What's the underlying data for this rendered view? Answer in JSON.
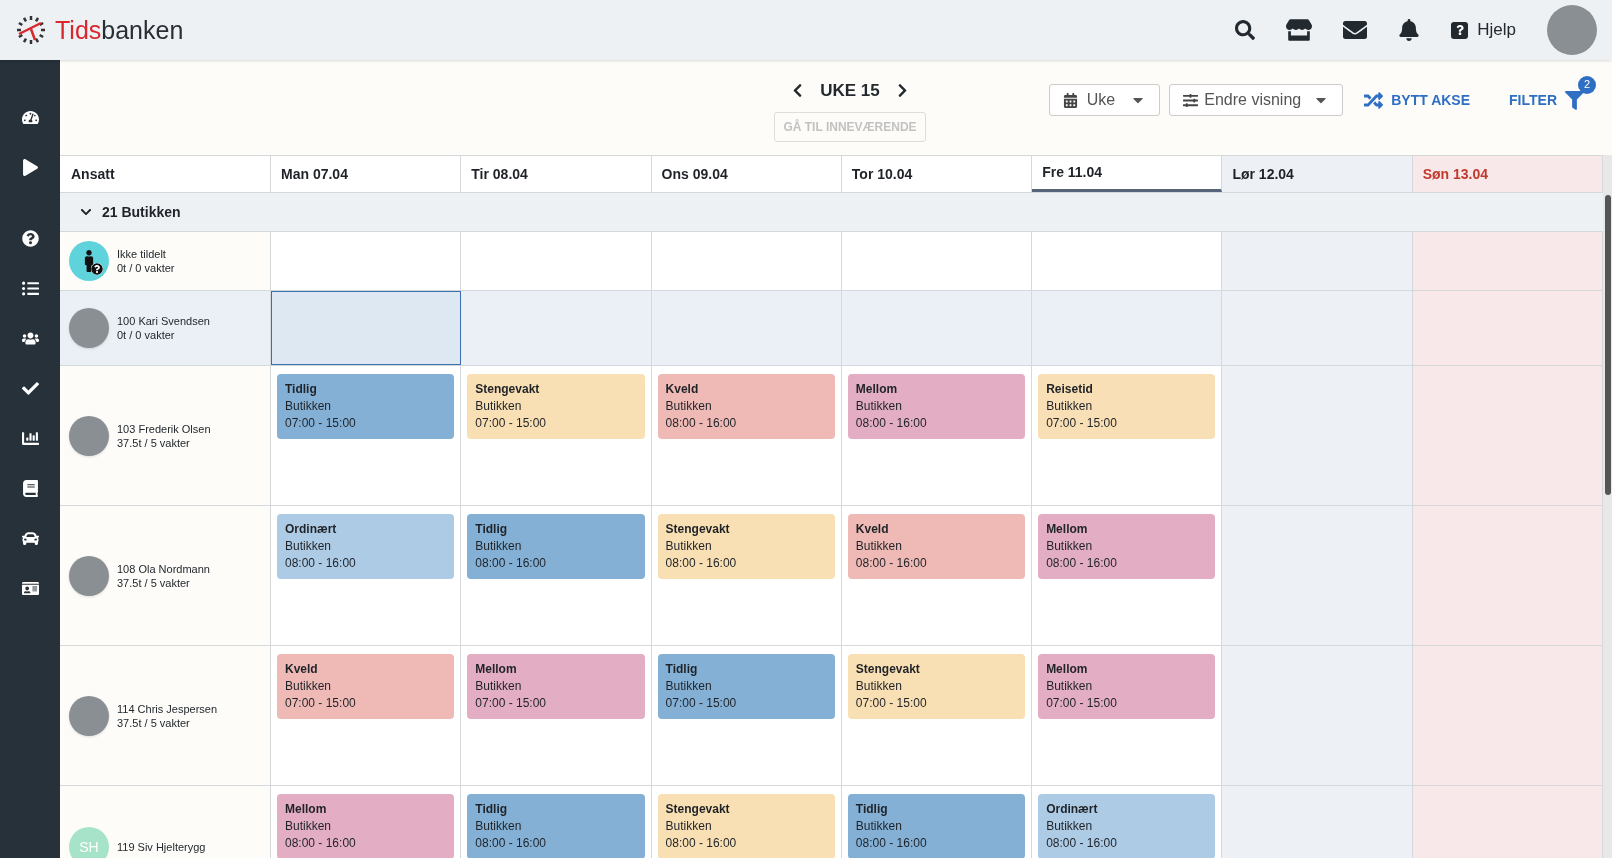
{
  "logo": {
    "accent": "Tids",
    "rest": "banken"
  },
  "header": {
    "help": "Hjelp"
  },
  "toolbar": {
    "week": "UKE 15",
    "goto_current": "GÅ TIL INNEVÆRENDE",
    "period_select": "Uke",
    "view_select": "Endre visning",
    "swap_axis": "BYTT AKSE",
    "filter": "FILTER",
    "filter_count": "2"
  },
  "table": {
    "employee_header": "Ansatt",
    "days": [
      {
        "label": "Man 07.04",
        "kind": "weekday",
        "selected": false
      },
      {
        "label": "Tir 08.04",
        "kind": "weekday",
        "selected": false
      },
      {
        "label": "Ons 09.04",
        "kind": "weekday",
        "selected": false
      },
      {
        "label": "Tor 10.04",
        "kind": "weekday",
        "selected": false
      },
      {
        "label": "Fre 11.04",
        "kind": "weekday",
        "selected": true
      },
      {
        "label": "Lør 12.04",
        "kind": "saturday",
        "selected": false
      },
      {
        "label": "Søn 13.04",
        "kind": "sunday",
        "selected": false
      }
    ],
    "group": {
      "label": "21 Butikken",
      "expanded": true
    },
    "employees": [
      {
        "name": "Ikke tildelt",
        "hours": "0t / 0 vakter",
        "avatar": {
          "kind": "unassigned"
        },
        "selected": false,
        "cells": [
          {
            "selected": false
          },
          {
            "selected": false
          },
          {
            "selected": false
          },
          {
            "selected": false
          },
          {
            "selected": false
          },
          {
            "selected": false
          },
          {
            "selected": false
          }
        ]
      },
      {
        "name": "100 Kari Svendsen",
        "hours": "0t / 0 vakter",
        "avatar": {
          "kind": "photo"
        },
        "selected": true,
        "cells": [
          {
            "selected": true
          },
          {
            "selected": false
          },
          {
            "selected": false
          },
          {
            "selected": false
          },
          {
            "selected": false
          },
          {
            "selected": false
          },
          {
            "selected": false
          }
        ]
      },
      {
        "name": "103 Frederik Olsen",
        "hours": "37.5t / 5 vakter",
        "avatar": {
          "kind": "photo"
        },
        "selected": false,
        "cells": [
          {
            "selected": false,
            "shift": {
              "title": "Tidlig",
              "place": "Butikken",
              "time": "07:00 - 15:00",
              "color": "#84b0d6"
            }
          },
          {
            "selected": false,
            "shift": {
              "title": "Stengevakt",
              "place": "Butikken",
              "time": "07:00 - 15:00",
              "color": "#f9dfb4"
            }
          },
          {
            "selected": false,
            "shift": {
              "title": "Kveld",
              "place": "Butikken",
              "time": "08:00 - 16:00",
              "color": "#efbab6"
            }
          },
          {
            "selected": false,
            "shift": {
              "title": "Mellom",
              "place": "Butikken",
              "time": "08:00 - 16:00",
              "color": "#e3adc4"
            }
          },
          {
            "selected": false,
            "shift": {
              "title": "Reisetid",
              "place": "Butikken",
              "time": "07:00 - 15:00",
              "color": "#f9dfb5"
            }
          },
          {
            "selected": false
          },
          {
            "selected": false
          }
        ]
      },
      {
        "name": "108 Ola Nordmann",
        "hours": "37.5t / 5 vakter",
        "avatar": {
          "kind": "photo"
        },
        "selected": false,
        "cells": [
          {
            "selected": false,
            "shift": {
              "title": "Ordinært",
              "place": "Butikken",
              "time": "08:00 - 16:00",
              "color": "#aecbe5"
            }
          },
          {
            "selected": false,
            "shift": {
              "title": "Tidlig",
              "place": "Butikken",
              "time": "08:00 - 16:00",
              "color": "#84b0d6"
            }
          },
          {
            "selected": false,
            "shift": {
              "title": "Stengevakt",
              "place": "Butikken",
              "time": "08:00 - 16:00",
              "color": "#f9dfb4"
            }
          },
          {
            "selected": false,
            "shift": {
              "title": "Kveld",
              "place": "Butikken",
              "time": "08:00 - 16:00",
              "color": "#efbab6"
            }
          },
          {
            "selected": false,
            "shift": {
              "title": "Mellom",
              "place": "Butikken",
              "time": "08:00 - 16:00",
              "color": "#e3adc4"
            }
          },
          {
            "selected": false
          },
          {
            "selected": false
          }
        ]
      },
      {
        "name": "114 Chris Jespersen",
        "hours": "37.5t / 5 vakter",
        "avatar": {
          "kind": "photo"
        },
        "selected": false,
        "cells": [
          {
            "selected": false,
            "shift": {
              "title": "Kveld",
              "place": "Butikken",
              "time": "07:00 - 15:00",
              "color": "#efbab6"
            }
          },
          {
            "selected": false,
            "shift": {
              "title": "Mellom",
              "place": "Butikken",
              "time": "07:00 - 15:00",
              "color": "#e3adc4"
            }
          },
          {
            "selected": false,
            "shift": {
              "title": "Tidlig",
              "place": "Butikken",
              "time": "07:00 - 15:00",
              "color": "#84b0d6"
            }
          },
          {
            "selected": false,
            "shift": {
              "title": "Stengevakt",
              "place": "Butikken",
              "time": "07:00 - 15:00",
              "color": "#f9dfb4"
            }
          },
          {
            "selected": false,
            "shift": {
              "title": "Mellom",
              "place": "Butikken",
              "time": "07:00 - 15:00",
              "color": "#e3adc4"
            }
          },
          {
            "selected": false
          },
          {
            "selected": false
          }
        ]
      },
      {
        "name": "119 Siv Hjelterygg",
        "avatar": {
          "kind": "initials",
          "initials": "SH"
        },
        "selected": false,
        "cells": [
          {
            "selected": false,
            "shift": {
              "title": "Mellom",
              "place": "Butikken",
              "time": "08:00 - 16:00",
              "color": "#e3adc4"
            }
          },
          {
            "selected": false,
            "shift": {
              "title": "Tidlig",
              "place": "Butikken",
              "time": "08:00 - 16:00",
              "color": "#84b0d6"
            }
          },
          {
            "selected": false,
            "shift": {
              "title": "Stengevakt",
              "place": "Butikken",
              "time": "08:00 - 16:00",
              "color": "#f9dfb4"
            }
          },
          {
            "selected": false,
            "shift": {
              "title": "Tidlig",
              "place": "Butikken",
              "time": "08:00 - 16:00",
              "color": "#84b0d6"
            }
          },
          {
            "selected": false,
            "shift": {
              "title": "Ordinært",
              "place": "Butikken",
              "time": "08:00 - 16:00",
              "color": "#aecbe5"
            }
          },
          {
            "selected": false
          },
          {
            "selected": false
          }
        ]
      }
    ]
  }
}
